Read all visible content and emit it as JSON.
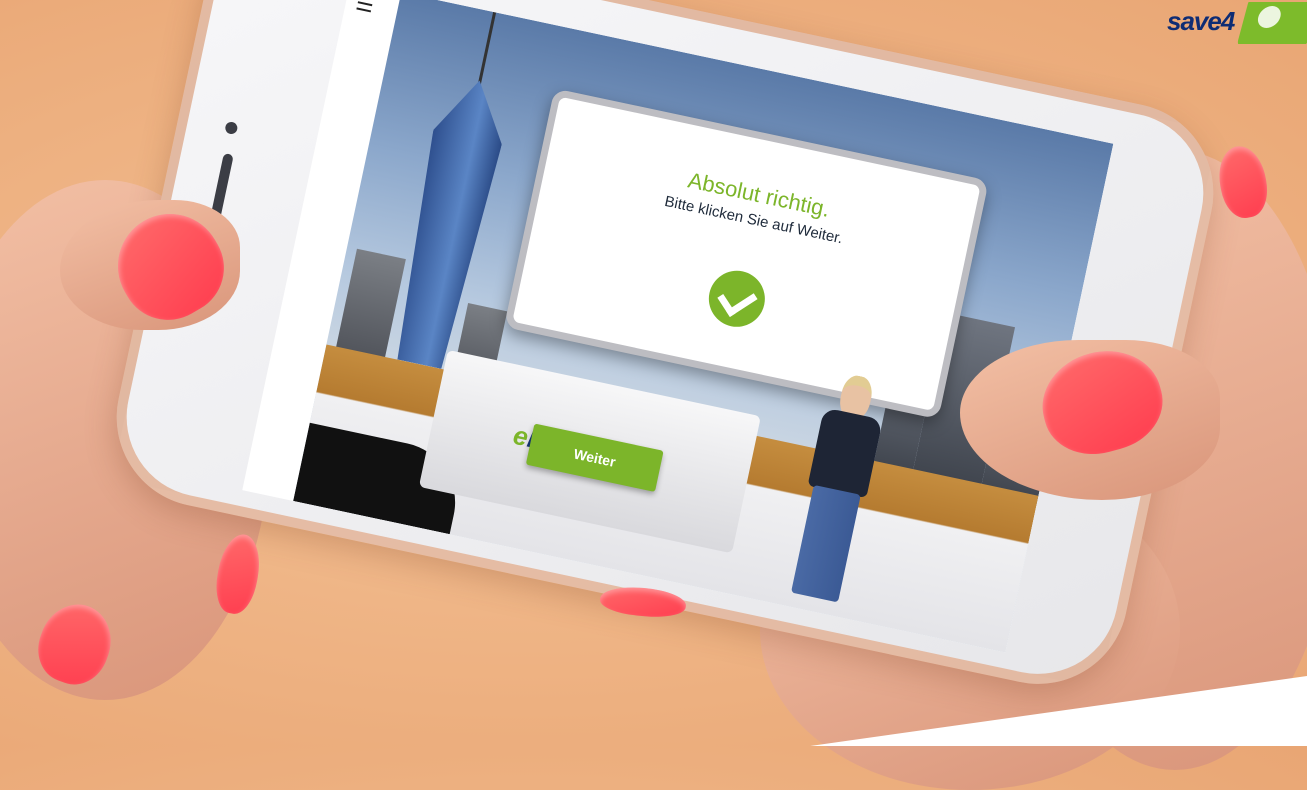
{
  "brand": {
    "name": "save4"
  },
  "app": {
    "menu_icon": "hamburger-menu-icon",
    "panel_title": "Absolut richtig.",
    "panel_subtitle": "Bitte klicken Sie auf Weiter.",
    "check_icon": "checkmark-circle-icon",
    "desk_logo": "eLe",
    "continue_label": "Weiter"
  },
  "colors": {
    "accent_green": "#7cb52a",
    "brand_navy": "#0e2c74",
    "nail_pink": "#ff4a5a"
  }
}
